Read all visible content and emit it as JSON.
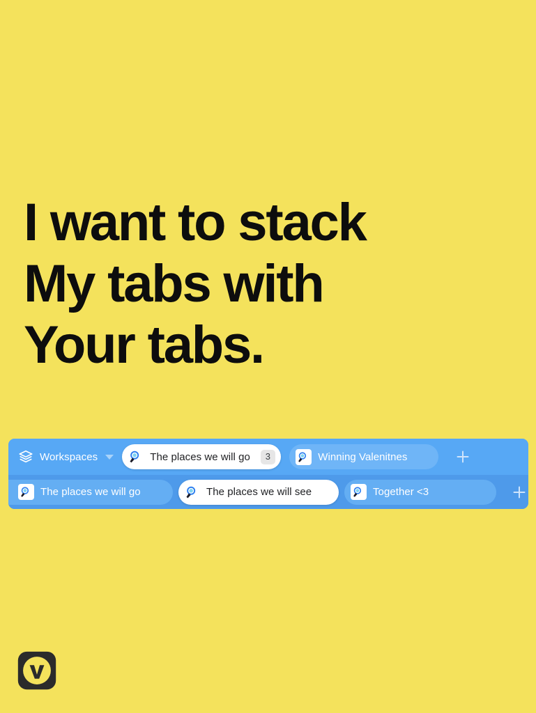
{
  "page": {
    "background_color": "#f4e25c",
    "headline_color": "#0d0d0d",
    "headline_lines": [
      "I want to stack",
      "My tabs with",
      "Your tabs."
    ]
  },
  "tabbar": {
    "panel_color_row1": "#57a8f5",
    "panel_color_row2": "#4e9aea",
    "workspaces": {
      "label": "Workspaces",
      "stack_icon": "stack-layers-icon",
      "caret_icon": "chevron-down-icon"
    },
    "row1": {
      "tabs": [
        {
          "title": "The places we will go",
          "favicon": "magnifier-search-icon",
          "active": true,
          "badge": "3"
        },
        {
          "title": "Winning Valenitnes",
          "favicon": "magnifier-search-icon",
          "active": false,
          "badge": ""
        }
      ],
      "new_tab_label": "+"
    },
    "row2": {
      "tabs": [
        {
          "title": "The places we will go",
          "favicon": "magnifier-search-icon",
          "active": false,
          "badge": ""
        },
        {
          "title": "The places we will see",
          "favicon": "magnifier-search-icon",
          "active": true,
          "badge": ""
        },
        {
          "title": "Together <3",
          "favicon": "magnifier-search-icon",
          "active": false,
          "badge": ""
        }
      ],
      "new_tab_label": "+"
    }
  },
  "branding": {
    "logo_name": "vivaldi-logo",
    "logo_color": "#2b2b2b"
  }
}
